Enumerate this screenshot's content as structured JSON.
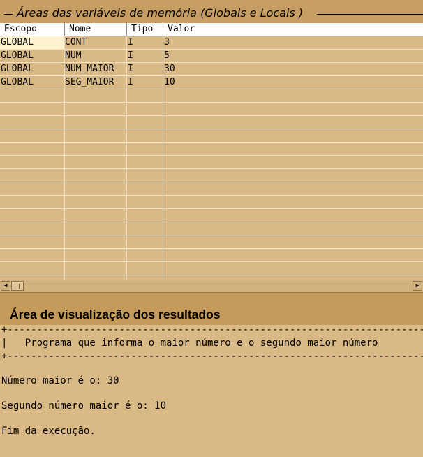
{
  "variables_panel": {
    "title": "Áreas das variáveis de memória (Globais e Locais )",
    "columns": [
      "Escopo",
      "Nome",
      "Tipo",
      "Valor"
    ],
    "rows": [
      [
        "GLOBAL",
        "CONT",
        "I",
        "3"
      ],
      [
        "GLOBAL",
        "NUM",
        "I",
        "5"
      ],
      [
        "GLOBAL",
        "NUM_MAIOR",
        "I",
        "30"
      ],
      [
        "GLOBAL",
        "SEG_MAIOR",
        "I",
        "10"
      ]
    ],
    "scroll_left_icon": "◀",
    "scroll_right_icon": "▶"
  },
  "results_panel": {
    "title": "Área de visualização dos resultados",
    "output_lines": [
      "+--------------------------------------------------------------------------------",
      "|   Programa que informa o maior número e o segundo maior número",
      "+--------------------------------------------------------------------------------",
      "",
      "Número maior é o: 30",
      "",
      "Segundo número maior é o: 10",
      "",
      "Fim da execução."
    ]
  },
  "colors": {
    "panel_bg": "#d9b985",
    "title_bar_bg": "#c59b5b",
    "header_bg": "#ffffff",
    "selected_cell_bg": "#fff3cf"
  }
}
